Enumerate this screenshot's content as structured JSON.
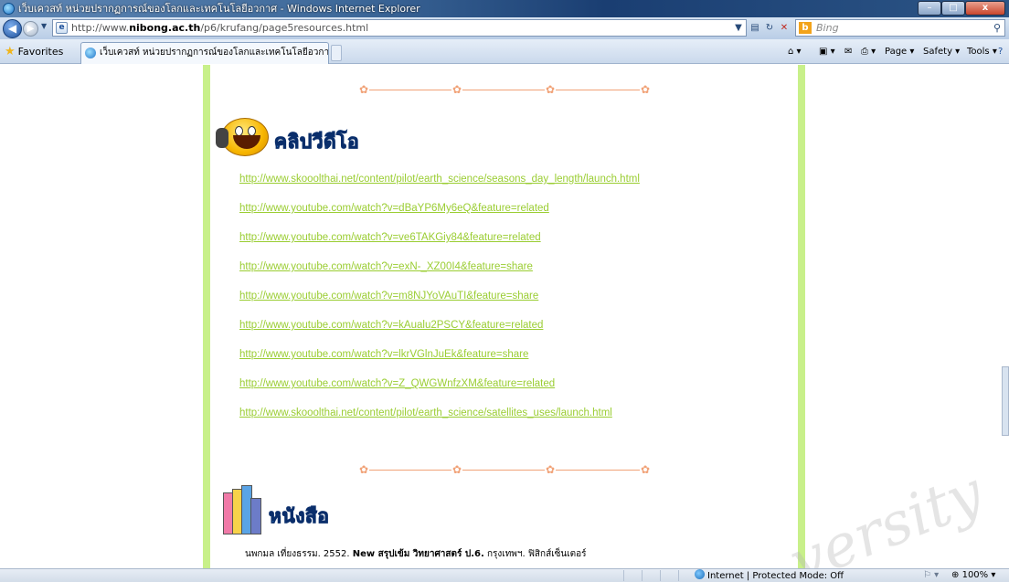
{
  "window": {
    "title": "เว็บเควสท์ หน่วยปรากฏการณ์ของโลกและเทคโนโลยีอวกาศ - Windows Internet Explorer",
    "controls": {
      "minimize": "–",
      "maximize": "□",
      "close": "x"
    }
  },
  "address_bar": {
    "url_prefix": "http://www.",
    "url_host": "nibong.ac.th",
    "url_path": "/p6/krufang/page5resources.html",
    "search_placeholder": "Bing"
  },
  "favorites_bar": {
    "favorites_label": "Favorites",
    "tab_title": "เว็บเควสท์ หน่วยปรากฏการณ์ของโลกและเทคโนโลยีอวกา...",
    "commands": {
      "page": "Page ▾",
      "safety": "Safety ▾",
      "tools": "Tools ▾"
    }
  },
  "content": {
    "video_section": {
      "title": "คลิปวีดีโอ",
      "links": [
        "http://www.skooolthai.net/content/pilot/earth_science/seasons_day_length/launch.html",
        "http://www.youtube.com/watch?v=dBaYP6My6eQ&feature=related",
        "http://www.youtube.com/watch?v=ve6TAKGiy84&feature=related",
        "http://www.youtube.com/watch?v=exN-_XZ00I4&feature=share",
        "http://www.youtube.com/watch?v=m8NJYoVAuTI&feature=share",
        "http://www.youtube.com/watch?v=kAualu2PSCY&feature=related",
        "http://www.youtube.com/watch?v=lkrVGlnJuEk&feature=share",
        "http://www.youtube.com/watch?v=Z_QWGWnfzXM&feature=related",
        "http://www.skooolthai.net/content/pilot/earth_science/satellites_uses/launch.html"
      ]
    },
    "book_section": {
      "title": "หนังสือ",
      "reference_prefix": "นพกมล เที่ยงธรรม. 2552.",
      "reference_bold": "New สรุปเข้ม วิทยาศาสตร์ ป.6.",
      "reference_suffix": "กรุงเทพฯ. ฟิสิกส์เซ็นเตอร์"
    },
    "watermark_text": "versity"
  },
  "status_bar": {
    "zone": "Internet | Protected Mode: Off",
    "zoom": "100%"
  },
  "colors": {
    "link": "#9acd32",
    "column_border": "#c8f08a",
    "divider": "#f1a277",
    "heading": "#2d7fd6"
  }
}
